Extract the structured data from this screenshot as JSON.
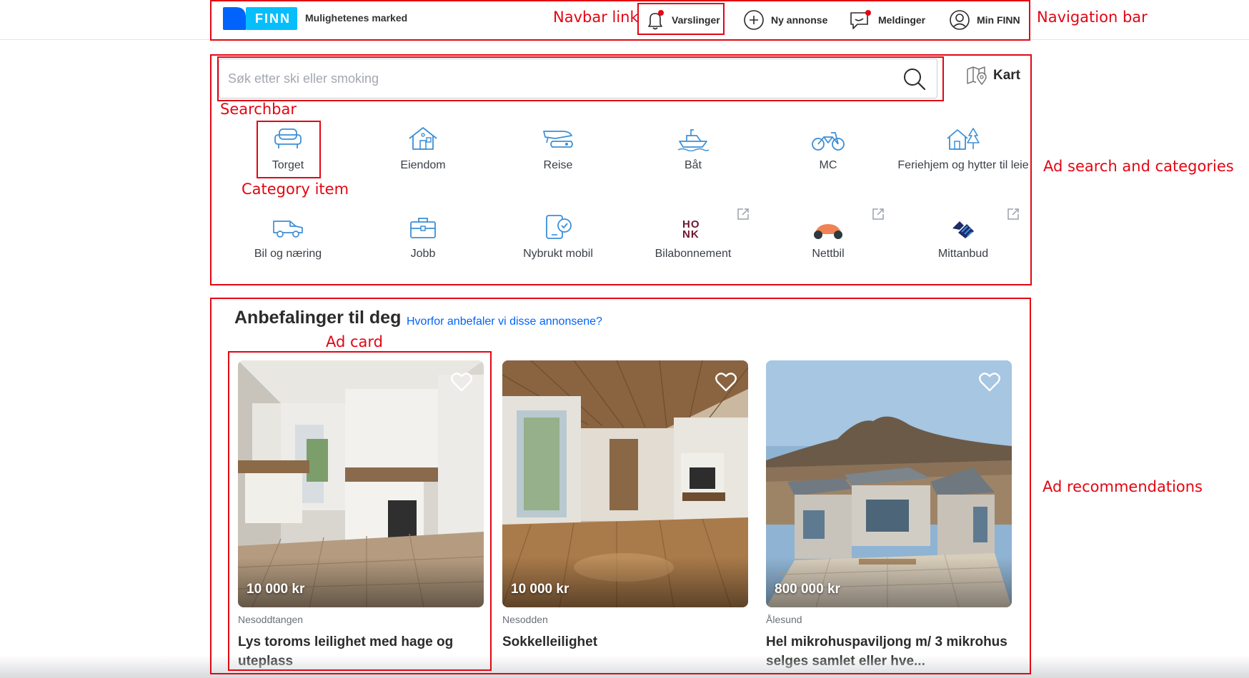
{
  "navbar": {
    "logo_text": "FINN",
    "tagline": "Mulighetenes marked",
    "links": [
      {
        "label": "Varslinger",
        "icon": "bell-icon"
      },
      {
        "label": "Ny annonse",
        "icon": "plus-circle-icon"
      },
      {
        "label": "Meldinger",
        "icon": "chat-icon"
      },
      {
        "label": "Min FINN",
        "icon": "user-circle-icon"
      }
    ]
  },
  "search": {
    "placeholder": "Søk etter ski eller smoking",
    "map_label": "Kart"
  },
  "categories": [
    {
      "label": "Torget",
      "icon": "sofa-icon"
    },
    {
      "label": "Eiendom",
      "icon": "house-icon"
    },
    {
      "label": "Reise",
      "icon": "plane-icon"
    },
    {
      "label": "Båt",
      "icon": "boat-icon"
    },
    {
      "label": "MC",
      "icon": "motorcycle-icon"
    },
    {
      "label": "Feriehjem og hytter til leie",
      "icon": "cabin-icon"
    },
    {
      "label": "Bil og næring",
      "icon": "car-icon"
    },
    {
      "label": "Jobb",
      "icon": "briefcase-icon"
    },
    {
      "label": "Nybrukt mobil",
      "icon": "phone-icon"
    },
    {
      "label": "Bilabonnement",
      "icon": "honk-logo-icon",
      "logo_text": "HONK",
      "external": true
    },
    {
      "label": "Nettbil",
      "icon": "nettbil-logo-icon",
      "external": true
    },
    {
      "label": "Mittanbud",
      "icon": "mittanbud-logo-icon",
      "external": true
    }
  ],
  "recommendations": {
    "title": "Anbefalinger til deg",
    "why_link": "Hvorfor anbefaler vi disse annonsene?",
    "ads": [
      {
        "price": "10 000 kr",
        "location": "Nesoddtangen",
        "title": "Lys toroms leilighet med hage og uteplass"
      },
      {
        "price": "10 000 kr",
        "location": "Nesodden",
        "title": "Sokkelleilighet"
      },
      {
        "price": "800 000 kr",
        "location": "Ålesund",
        "title": "Hel mikrohuspaviljong m/ 3 mikrohus selges samlet eller hve..."
      }
    ]
  },
  "annotations": {
    "navigation_bar": "Navigation bar",
    "navbar_link": "Navbar link",
    "searchbar": "Searchbar",
    "category_item": "Category item",
    "ad_search_categories": "Ad search and categories",
    "ad_card": "Ad card",
    "ad_recommendations": "Ad recommendations"
  },
  "colors": {
    "brand_blue": "#0063fb",
    "logo_light": "#06befb",
    "annotation_red": "#e30613",
    "icon_blue": "#3d8fd6"
  }
}
